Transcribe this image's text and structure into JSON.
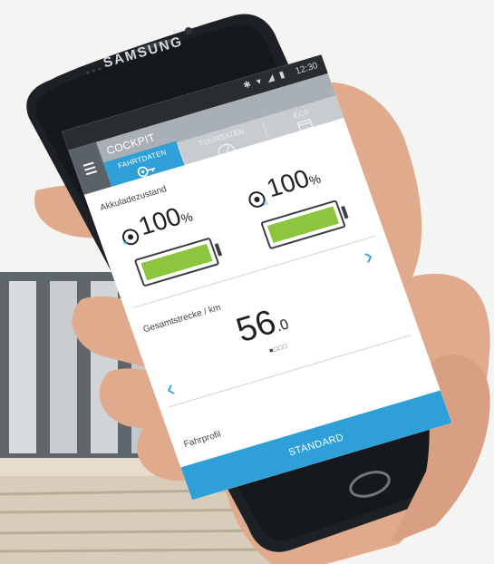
{
  "device": {
    "brand": "SAMSUNG"
  },
  "status": {
    "time": "12:30"
  },
  "app": {
    "title": "COCKPIT"
  },
  "tabs": [
    {
      "label": "FAHRTDATEN",
      "active": true
    },
    {
      "label": "TOURDATEN",
      "active": false
    },
    {
      "label": "ECS",
      "active": false
    }
  ],
  "battery": {
    "label": "Akkuladezustand",
    "items": [
      {
        "value": "100",
        "unit": "%",
        "level": 1.0,
        "icon": "battery-left-icon"
      },
      {
        "value": "100",
        "unit": "%",
        "level": 1.0,
        "icon": "battery-right-icon"
      }
    ]
  },
  "distance": {
    "label": "Gesamtstrecke / km",
    "integer": "56",
    "decimal": ".0",
    "page_indicator": "■□□□"
  },
  "profile": {
    "label": "Fahrprofil",
    "button": "STANDARD"
  },
  "colors": {
    "accent": "#2f9fd8",
    "battery_fill": "#8cc63f",
    "appbar": "#a9b0b5"
  }
}
